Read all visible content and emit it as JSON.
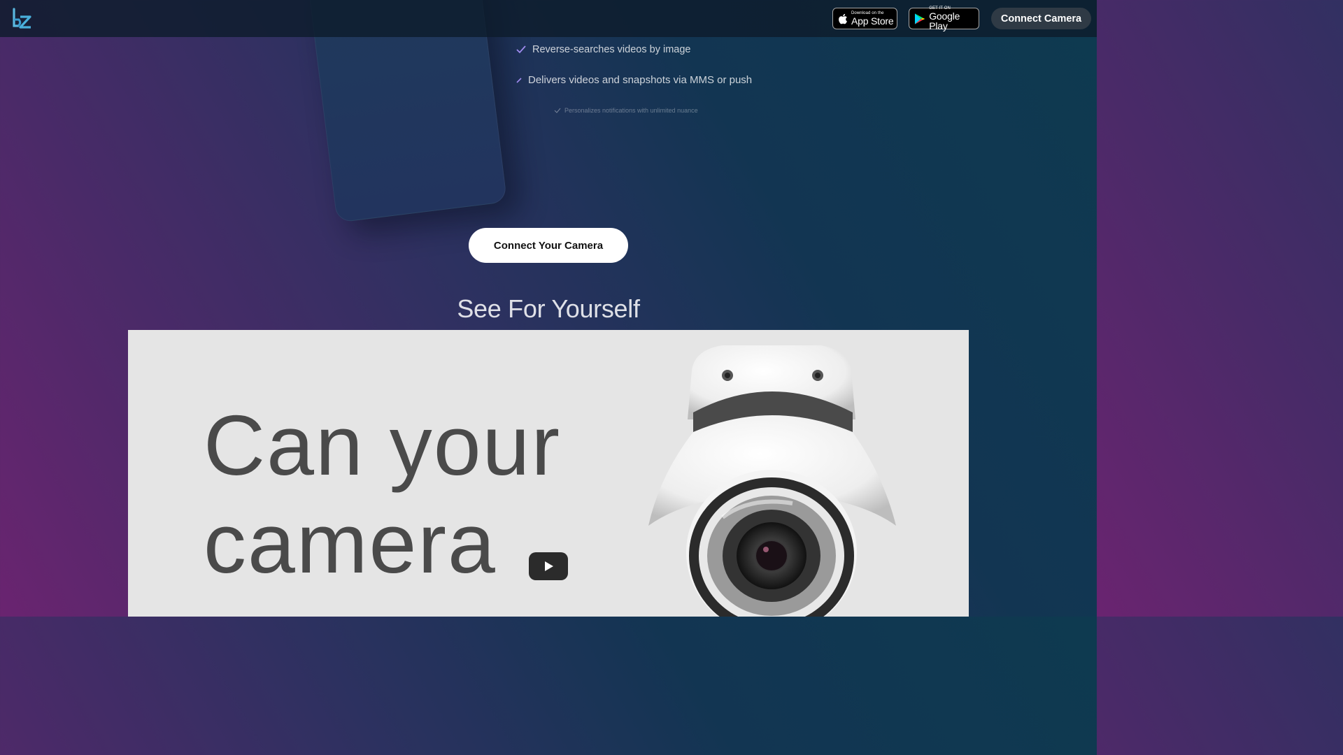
{
  "header": {
    "logo": "bz-logo-icon",
    "faded_heading": "",
    "app_store": {
      "small": "Download on the",
      "big": "App Store"
    },
    "google_play": {
      "small": "GET IT ON",
      "big": "Google Play"
    },
    "connect_button": "Connect Camera"
  },
  "features": [
    "Reverse-searches videos by image",
    "Delivers videos and snapshots via MMS or push",
    "Personalizes notifications with unlimited nuance"
  ],
  "cta": "Connect Your Camera",
  "section_title": "See For Yourself",
  "video": {
    "line1": "Can your",
    "line2": "camera",
    "play_icon": "play-icon",
    "image": "dome-security-camera"
  },
  "colors": {
    "accent_check": "#a08cf0",
    "video_bg": "#e5e5e5"
  }
}
